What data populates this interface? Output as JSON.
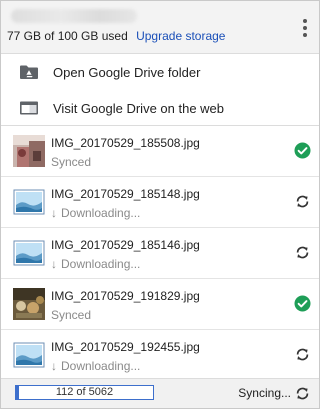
{
  "header": {
    "storage_text": "77 GB of 100 GB used",
    "upgrade_label": "Upgrade storage",
    "menu_icon": "more-vert-icon"
  },
  "actions": [
    {
      "label": "Open Google Drive folder",
      "icon": "drive-folder-icon"
    },
    {
      "label": "Visit Google Drive on the web",
      "icon": "browser-window-icon"
    }
  ],
  "files": [
    {
      "name": "IMG_20170529_185508.jpg",
      "status": "Synced",
      "state": "synced",
      "thumb": "photo-thumbnail"
    },
    {
      "name": "IMG_20170529_185148.jpg",
      "status": "Downloading...",
      "state": "downloading",
      "thumb": "image-placeholder"
    },
    {
      "name": "IMG_20170529_185146.jpg",
      "status": "Downloading...",
      "state": "downloading",
      "thumb": "image-placeholder"
    },
    {
      "name": "IMG_20170529_191829.jpg",
      "status": "Synced",
      "state": "synced",
      "thumb": "photo-thumbnail"
    },
    {
      "name": "IMG_20170529_192455.jpg",
      "status": "Downloading...",
      "state": "downloading",
      "thumb": "image-placeholder"
    }
  ],
  "footer": {
    "progress_text": "112 of 5062",
    "progress_done": 112,
    "progress_total": 5062,
    "status_label": "Syncing..."
  },
  "colors": {
    "accent_blue": "#1a4fb8",
    "progress_blue": "#3d6fcc",
    "synced_green": "#1e9e57"
  }
}
